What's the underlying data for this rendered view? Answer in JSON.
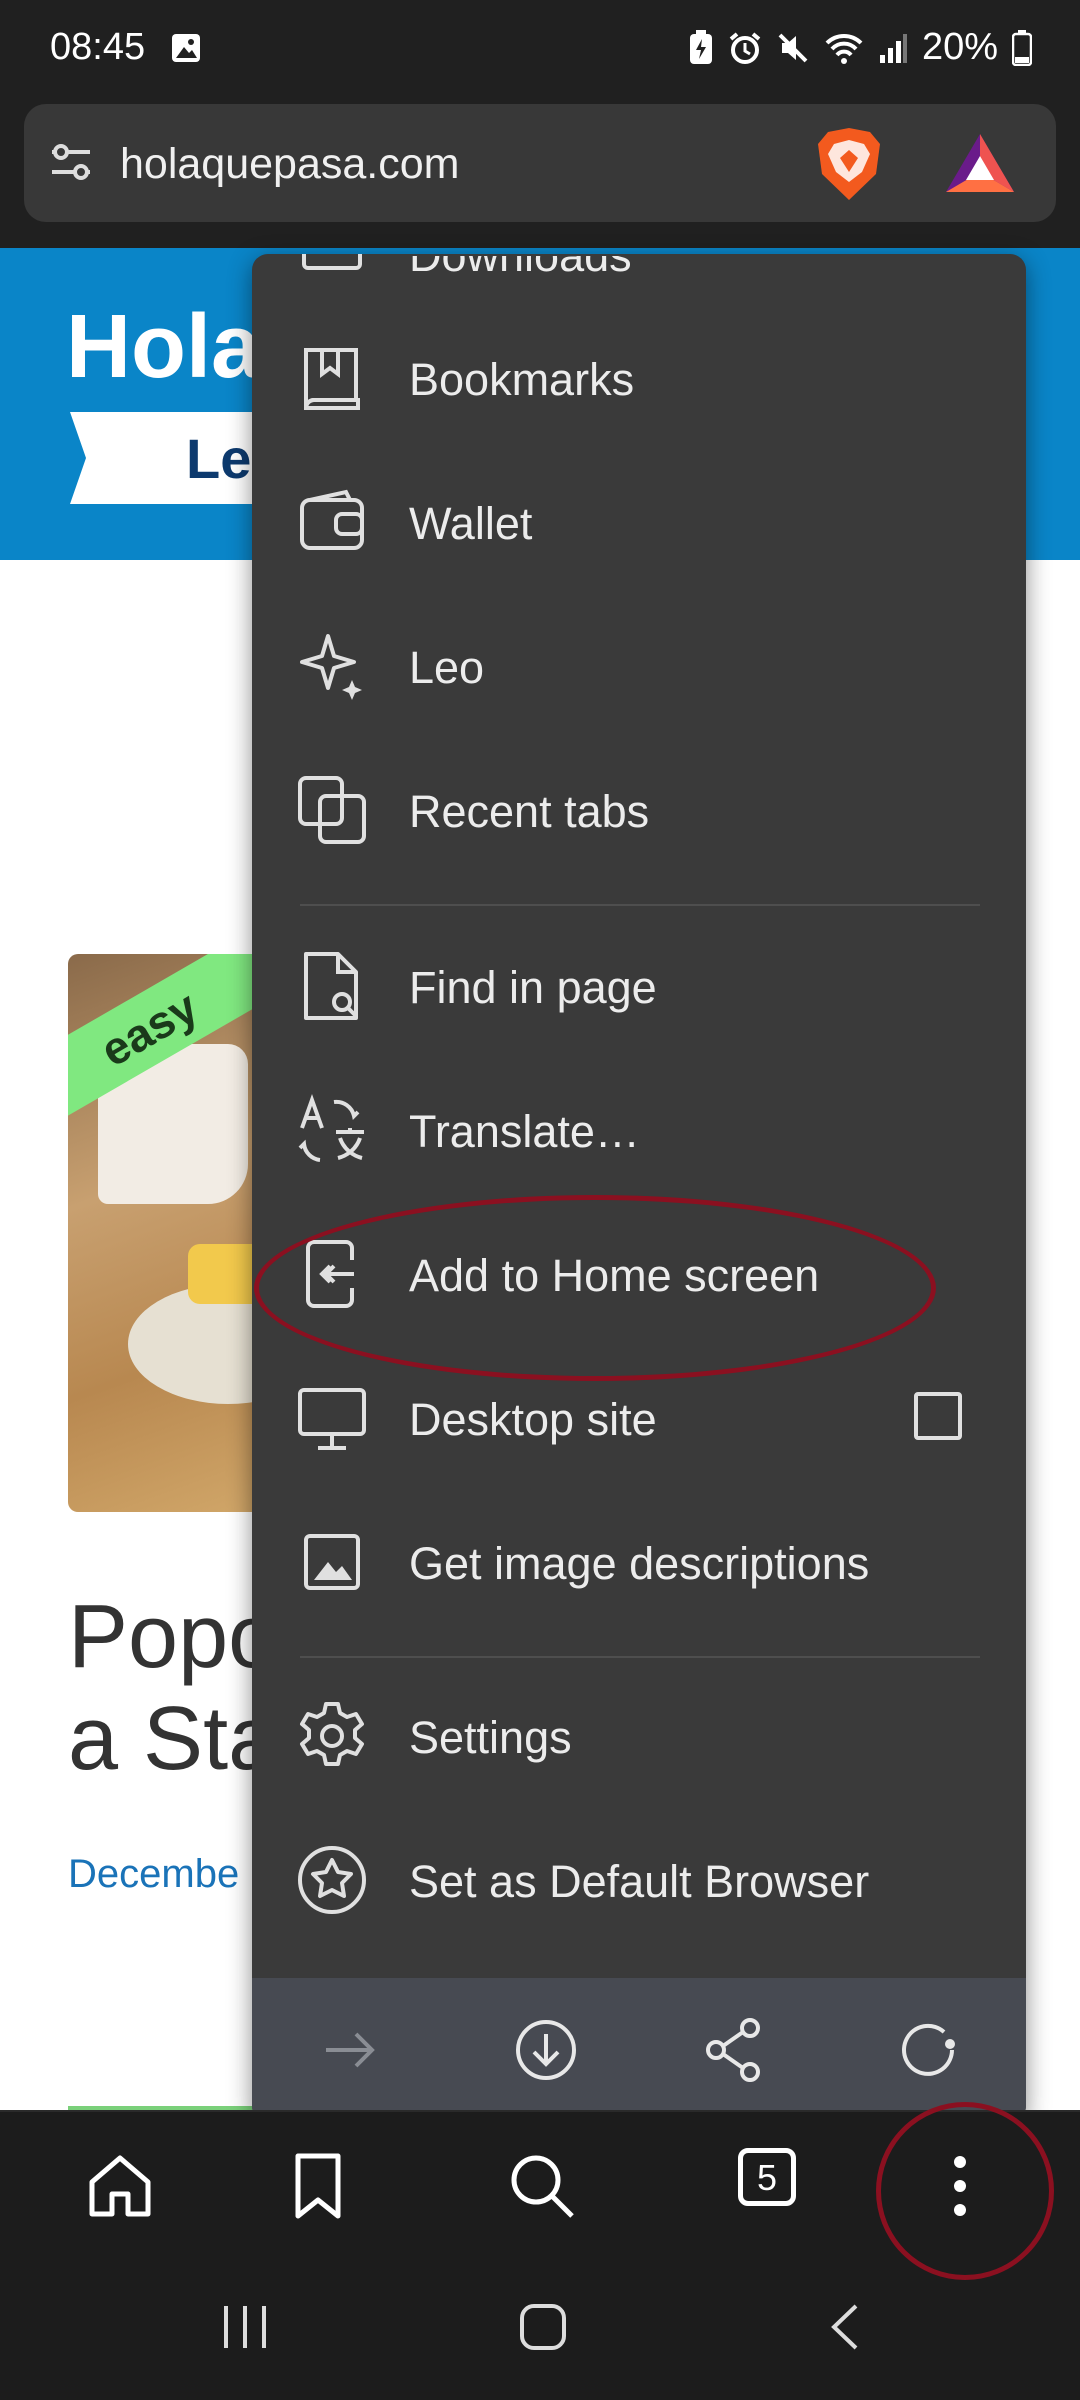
{
  "status_bar": {
    "time": "08:45",
    "battery_pct": "20%"
  },
  "address_bar": {
    "url": "holaquepasa.com"
  },
  "page": {
    "logo": "Hola",
    "ribbon": "Lea",
    "badge": "easy",
    "title_line1": "Popo",
    "title_line2": "a Sta",
    "date": "Decembe"
  },
  "menu": {
    "partial_label": "Downloads",
    "items": [
      {
        "label": "Bookmarks",
        "icon": "bookmarks-icon"
      },
      {
        "label": "Wallet",
        "icon": "wallet-icon"
      },
      {
        "label": "Leo",
        "icon": "leo-sparkle-icon"
      },
      {
        "label": "Recent tabs",
        "icon": "recent-tabs-icon"
      },
      {
        "label": "Find in page",
        "icon": "find-in-page-icon"
      },
      {
        "label": "Translate…",
        "icon": "translate-icon"
      },
      {
        "label": "Add to Home screen",
        "icon": "add-to-home-icon"
      },
      {
        "label": "Desktop site",
        "icon": "desktop-icon",
        "checked": false
      },
      {
        "label": "Get image descriptions",
        "icon": "image-icon"
      },
      {
        "label": "Settings",
        "icon": "gear-icon"
      },
      {
        "label": "Set as Default Browser",
        "icon": "star-badge-icon"
      }
    ],
    "footer": [
      "forward-arrow-icon",
      "download-icon",
      "share-icon",
      "reload-icon"
    ]
  },
  "toolbar": {
    "tab_count": "5",
    "items": [
      "home-icon",
      "bookmark-icon",
      "search-icon",
      "tabs-icon",
      "more-vert-icon"
    ]
  },
  "colors": {
    "menu_bg": "#3a3a3a",
    "footer_bg": "#474a52",
    "banner": "#0a85c8",
    "annotation": "#8b1020"
  }
}
